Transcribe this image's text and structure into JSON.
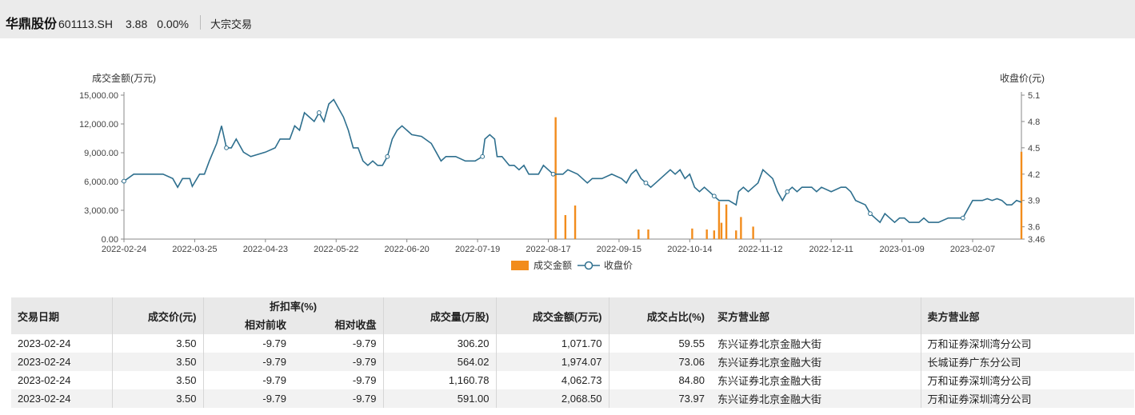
{
  "header": {
    "stock_name": "华鼎股份",
    "stock_code": "601113.SH",
    "price": "3.88",
    "change": "0.00%",
    "section": "大宗交易"
  },
  "chart_data": {
    "type": "bar+line",
    "left_axis_label": "成交金额(万元)",
    "right_axis_label": "收盘价(元)",
    "left_ylim": [
      0,
      15000
    ],
    "left_ticks": [
      "0.00",
      "3,000.00",
      "6,000.00",
      "9,000.00",
      "12,000.00",
      "15,000.00"
    ],
    "right_ylim": [
      3.46,
      5.1
    ],
    "right_ticks": [
      "3.46",
      "3.6",
      "3.9",
      "4.2",
      "4.5",
      "4.8",
      "5.1"
    ],
    "x_ticks": [
      "2022-02-24",
      "2022-03-25",
      "2022-04-23",
      "2022-05-22",
      "2022-06-20",
      "2022-07-19",
      "2022-08-17",
      "2022-09-15",
      "2022-10-14",
      "2022-11-12",
      "2022-12-11",
      "2023-01-09",
      "2023-02-07"
    ],
    "legend": [
      {
        "name": "成交金额",
        "color": "#f28c1c"
      },
      {
        "name": "收盘价",
        "color": "#2e6f8e"
      }
    ],
    "series": [
      {
        "name": "收盘价",
        "kind": "line",
        "color": "#2e6f8e",
        "points": [
          [
            0,
            4.12
          ],
          [
            4,
            4.2
          ],
          [
            12,
            4.2
          ],
          [
            16,
            4.2
          ],
          [
            20,
            4.15
          ],
          [
            22,
            4.05
          ],
          [
            24,
            4.15
          ],
          [
            27,
            4.15
          ],
          [
            28,
            4.06
          ],
          [
            31,
            4.2
          ],
          [
            33,
            4.2
          ],
          [
            35,
            4.35
          ],
          [
            38,
            4.55
          ],
          [
            40,
            4.75
          ],
          [
            42,
            4.5
          ],
          [
            44,
            4.5
          ],
          [
            46,
            4.6
          ],
          [
            49,
            4.45
          ],
          [
            52,
            4.4
          ],
          [
            58,
            4.45
          ],
          [
            62,
            4.5
          ],
          [
            64,
            4.6
          ],
          [
            68,
            4.6
          ],
          [
            70,
            4.75
          ],
          [
            72,
            4.7
          ],
          [
            74,
            4.9
          ],
          [
            76,
            4.85
          ],
          [
            78,
            4.8
          ],
          [
            80,
            4.9
          ],
          [
            82,
            4.8
          ],
          [
            84,
            5.0
          ],
          [
            86,
            5.05
          ],
          [
            88,
            4.95
          ],
          [
            90,
            4.85
          ],
          [
            92,
            4.7
          ],
          [
            94,
            4.5
          ],
          [
            96,
            4.5
          ],
          [
            98,
            4.35
          ],
          [
            100,
            4.3
          ],
          [
            102,
            4.35
          ],
          [
            104,
            4.3
          ],
          [
            106,
            4.3
          ],
          [
            108,
            4.4
          ],
          [
            110,
            4.6
          ],
          [
            112,
            4.7
          ],
          [
            114,
            4.75
          ],
          [
            116,
            4.7
          ],
          [
            118,
            4.65
          ],
          [
            122,
            4.63
          ],
          [
            126,
            4.55
          ],
          [
            128,
            4.45
          ],
          [
            130,
            4.35
          ],
          [
            132,
            4.4
          ],
          [
            136,
            4.4
          ],
          [
            140,
            4.35
          ],
          [
            144,
            4.35
          ],
          [
            147,
            4.4
          ],
          [
            148,
            4.6
          ],
          [
            150,
            4.65
          ],
          [
            152,
            4.6
          ],
          [
            153,
            4.4
          ],
          [
            155,
            4.4
          ],
          [
            158,
            4.3
          ],
          [
            160,
            4.3
          ],
          [
            162,
            4.25
          ],
          [
            164,
            4.3
          ],
          [
            166,
            4.2
          ],
          [
            170,
            4.2
          ],
          [
            172,
            4.3
          ],
          [
            174,
            4.25
          ],
          [
            176,
            4.2
          ],
          [
            180,
            4.2
          ],
          [
            182,
            4.25
          ],
          [
            186,
            4.2
          ],
          [
            188,
            4.15
          ],
          [
            190,
            4.1
          ],
          [
            192,
            4.15
          ],
          [
            196,
            4.15
          ],
          [
            200,
            4.2
          ],
          [
            204,
            4.15
          ],
          [
            206,
            4.1
          ],
          [
            208,
            4.2
          ],
          [
            210,
            4.25
          ],
          [
            212,
            4.15
          ],
          [
            214,
            4.1
          ],
          [
            216,
            4.05
          ],
          [
            218,
            4.1
          ],
          [
            220,
            4.15
          ],
          [
            222,
            4.2
          ],
          [
            224,
            4.25
          ],
          [
            226,
            4.2
          ],
          [
            228,
            4.25
          ],
          [
            230,
            4.15
          ],
          [
            232,
            4.2
          ],
          [
            234,
            4.05
          ],
          [
            236,
            4.0
          ],
          [
            238,
            4.05
          ],
          [
            240,
            4.0
          ],
          [
            242,
            3.95
          ],
          [
            244,
            3.9
          ],
          [
            248,
            3.9
          ],
          [
            251,
            3.85
          ],
          [
            252,
            4.0
          ],
          [
            254,
            4.05
          ],
          [
            256,
            4.0
          ],
          [
            258,
            4.05
          ],
          [
            260,
            4.1
          ],
          [
            262,
            4.25
          ],
          [
            264,
            4.2
          ],
          [
            266,
            4.15
          ],
          [
            268,
            4.0
          ],
          [
            270,
            3.9
          ],
          [
            272,
            4.0
          ],
          [
            274,
            4.05
          ],
          [
            276,
            4.0
          ],
          [
            278,
            4.05
          ],
          [
            280,
            4.05
          ],
          [
            282,
            4.05
          ],
          [
            284,
            4.0
          ],
          [
            286,
            4.05
          ],
          [
            290,
            4.0
          ],
          [
            294,
            4.05
          ],
          [
            296,
            4.05
          ],
          [
            298,
            4.0
          ],
          [
            300,
            3.9
          ],
          [
            304,
            3.85
          ],
          [
            306,
            3.75
          ],
          [
            308,
            3.7
          ],
          [
            310,
            3.65
          ],
          [
            312,
            3.75
          ],
          [
            314,
            3.7
          ],
          [
            316,
            3.65
          ],
          [
            318,
            3.7
          ],
          [
            320,
            3.7
          ],
          [
            322,
            3.65
          ],
          [
            326,
            3.65
          ],
          [
            328,
            3.7
          ],
          [
            330,
            3.65
          ],
          [
            334,
            3.65
          ],
          [
            338,
            3.7
          ],
          [
            344,
            3.7
          ],
          [
            346,
            3.8
          ],
          [
            348,
            3.9
          ],
          [
            352,
            3.9
          ],
          [
            354,
            3.92
          ],
          [
            356,
            3.9
          ],
          [
            358,
            3.92
          ],
          [
            360,
            3.9
          ],
          [
            362,
            3.85
          ],
          [
            364,
            3.85
          ],
          [
            366,
            3.9
          ],
          [
            368,
            3.88
          ]
        ]
      },
      {
        "name": "成交金额",
        "kind": "bar",
        "color": "#f28c1c",
        "points": [
          [
            177,
            12700
          ],
          [
            181,
            2500
          ],
          [
            185,
            3500
          ],
          [
            211,
            1000
          ],
          [
            215,
            1000
          ],
          [
            233,
            1100
          ],
          [
            239,
            1000
          ],
          [
            242,
            900
          ],
          [
            244,
            3900
          ],
          [
            245,
            1700
          ],
          [
            247,
            3600
          ],
          [
            251,
            900
          ],
          [
            253,
            2300
          ],
          [
            258,
            1300
          ],
          [
            368,
            9100
          ]
        ]
      }
    ]
  },
  "table": {
    "headers": {
      "date": "交易日期",
      "price": "成交价(元)",
      "discount_group": "折扣率(%)",
      "discount_prev": "相对前收",
      "discount_close": "相对收盘",
      "volume": "成交量(万股)",
      "amount": "成交金额(万元)",
      "ratio": "成交占比(%)",
      "buyer": "买方营业部",
      "seller": "卖方营业部"
    },
    "rows": [
      {
        "date": "2023-02-24",
        "price": "3.50",
        "prev": "-9.79",
        "close": "-9.79",
        "volume": "306.20",
        "amount": "1,071.70",
        "ratio": "59.55",
        "buyer": "东兴证券北京金融大街",
        "seller": "万和证券深圳湾分公司"
      },
      {
        "date": "2023-02-24",
        "price": "3.50",
        "prev": "-9.79",
        "close": "-9.79",
        "volume": "564.02",
        "amount": "1,974.07",
        "ratio": "73.06",
        "buyer": "东兴证券北京金融大街",
        "seller": "长城证券广东分公司"
      },
      {
        "date": "2023-02-24",
        "price": "3.50",
        "prev": "-9.79",
        "close": "-9.79",
        "volume": "1,160.78",
        "amount": "4,062.73",
        "ratio": "84.80",
        "buyer": "东兴证券北京金融大街",
        "seller": "万和证券深圳湾分公司"
      },
      {
        "date": "2023-02-24",
        "price": "3.50",
        "prev": "-9.79",
        "close": "-9.79",
        "volume": "591.00",
        "amount": "2,068.50",
        "ratio": "73.97",
        "buyer": "东兴证券北京金融大街",
        "seller": "万和证券深圳湾分公司"
      }
    ]
  }
}
